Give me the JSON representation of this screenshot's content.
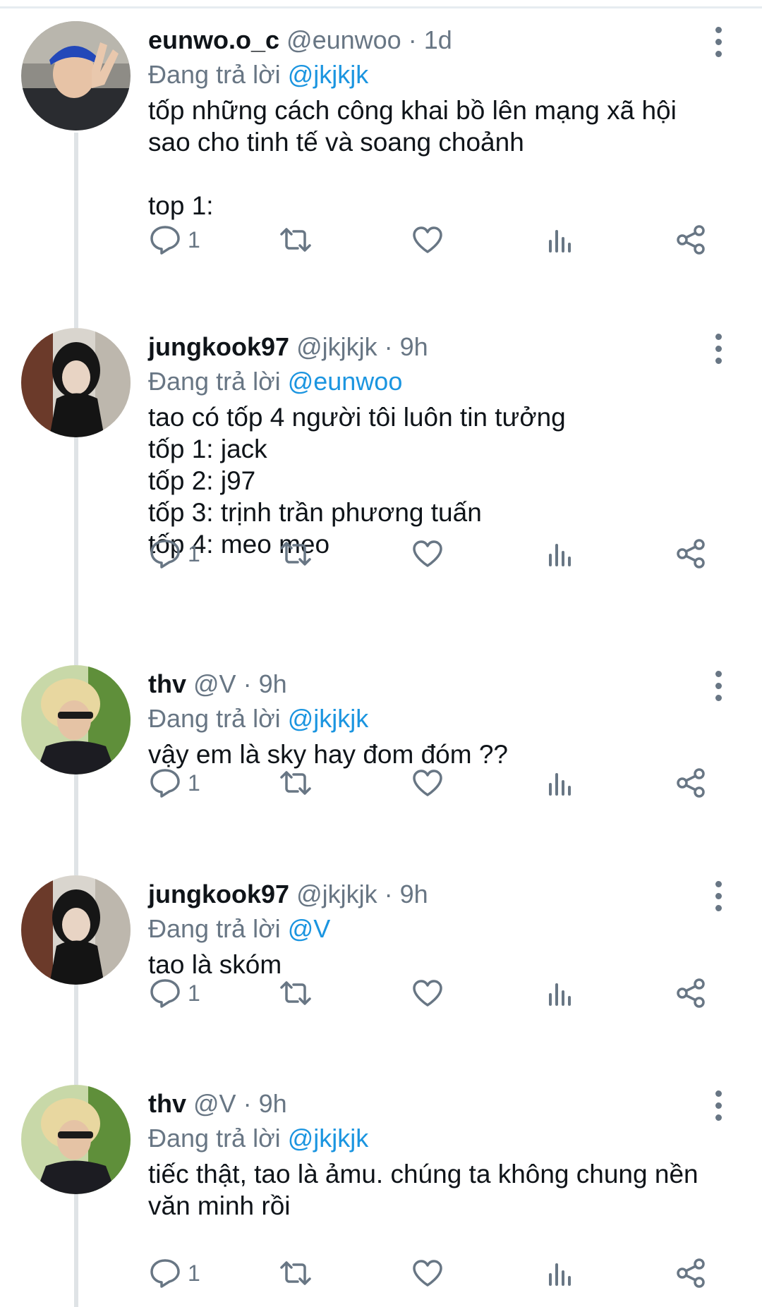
{
  "replying_prefix": "Đang trả lời ",
  "tweets": [
    {
      "name": "eunwo.o_c",
      "meta": "@eunwoo · 1d",
      "replying_to": "@jkjkjk",
      "text": "tốp những cách công khai bồ lên mạng xã hội\nsao cho tinh tế và soang choảnh\n\ntop 1:",
      "reply_count": "1"
    },
    {
      "name": "jungkook97",
      "meta": "@jkjkjk · 9h",
      "replying_to": "@eunwoo",
      "text": "tao có tốp 4 người tôi luôn tin tưởng\ntốp 1: jack\ntốp 2: j97\ntốp 3: trịnh trần phương tuấn\ntốp 4: meo meo",
      "reply_count": "1"
    },
    {
      "name": "thv",
      "meta": "@V · 9h",
      "replying_to": "@jkjkjk",
      "text": "vậy em là sky hay đom đóm ??",
      "reply_count": "1"
    },
    {
      "name": "jungkook97",
      "meta": "@jkjkjk · 9h",
      "replying_to": "@V",
      "text": "tao là skóm",
      "reply_count": "1"
    },
    {
      "name": "thv",
      "meta": "@V · 9h",
      "replying_to": "@jkjkjk",
      "text": "tiếc thật, tao là ảmu. chúng ta không chung nền\nvăn minh rồi",
      "reply_count": "1"
    }
  ],
  "icons": {
    "reply": "reply-icon",
    "retweet": "retweet-icon",
    "like": "heart-icon",
    "stats": "analytics-icon",
    "share": "share-icon",
    "more": "more-vertical-icon"
  },
  "colors": {
    "link": "#1b95e0",
    "secondary_text": "#687684",
    "thread_line": "#dfe3e6"
  }
}
